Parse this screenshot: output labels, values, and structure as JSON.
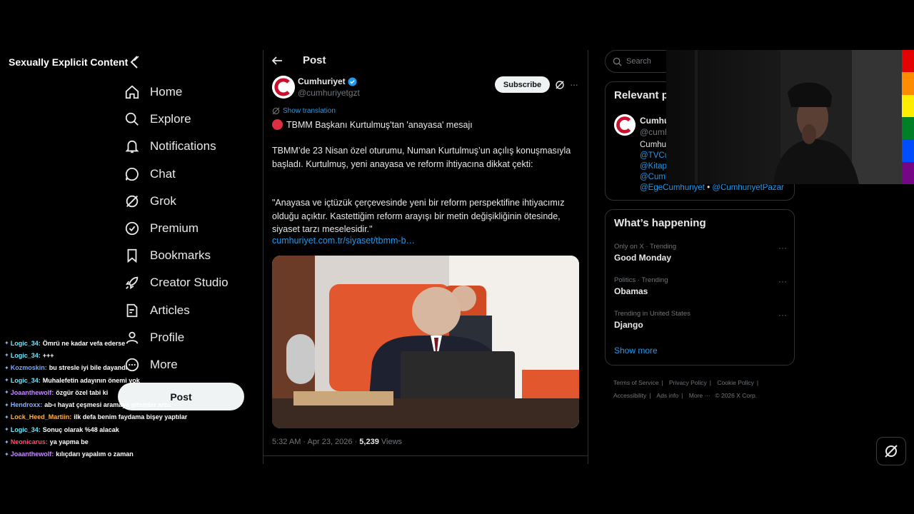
{
  "overlay": {
    "content_warning": "Sexually Explicit Content"
  },
  "nav": {
    "items": [
      {
        "label": "Home",
        "icon": "home-icon"
      },
      {
        "label": "Explore",
        "icon": "search-icon"
      },
      {
        "label": "Notifications",
        "icon": "bell-icon"
      },
      {
        "label": "Chat",
        "icon": "chat-bubble-icon"
      },
      {
        "label": "Grok",
        "icon": "grok-icon"
      },
      {
        "label": "Premium",
        "icon": "premium-badge-icon"
      },
      {
        "label": "Bookmarks",
        "icon": "bookmark-icon"
      },
      {
        "label": "Creator Studio",
        "icon": "rocket-icon"
      },
      {
        "label": "Articles",
        "icon": "article-edit-icon"
      },
      {
        "label": "Profile",
        "icon": "person-icon"
      },
      {
        "label": "More",
        "icon": "more-circle-icon"
      }
    ],
    "post_button": "Post"
  },
  "chat": {
    "messages": [
      {
        "user": "Logic_34:",
        "color": "#6ee7ff",
        "text": "Ömrü ne kadar vefa ederse"
      },
      {
        "user": "Logic_34:",
        "color": "#6ee7ff",
        "text": "+++"
      },
      {
        "user": "Kozmoskin:",
        "color": "#7aa7ff",
        "text": "bu stresle iyi bile dayandı"
      },
      {
        "user": "Logic_34:",
        "color": "#6ee7ff",
        "text": "Muhalefetin adayının önemi yok"
      },
      {
        "user": "Joaanthewolf:",
        "color": "#c98cff",
        "text": "özgür özel tabi ki"
      },
      {
        "user": "Hendroxx:",
        "color": "#8ab4ff",
        "text": "ab-ı hayat çeşmesi aramaya gitsinler artık"
      },
      {
        "user": "Lock_Heed_Martiin:",
        "color": "#ffb347",
        "text": "ilk defa benim faydama bişey yaptılar"
      },
      {
        "user": "Logic_34:",
        "color": "#6ee7ff",
        "text": "Sonuç olarak %48 alacak"
      },
      {
        "user": "Neonicarus:",
        "color": "#ff4d6d",
        "text": "ya yapma be"
      },
      {
        "user": "Joaanthewolf:",
        "color": "#c98cff",
        "text": "kılıçdarı yapalım o zaman"
      }
    ]
  },
  "post": {
    "page_title": "Post",
    "author_name": "Cumhuriyet",
    "author_handle": "@cumhuriyetgzt",
    "subscribe_label": "Subscribe",
    "show_translation": "Show translation",
    "headline": "TBMM Başkanı Kurtulmuş'tan 'anayasa' mesajı",
    "paragraph1": "TBMM’de 23 Nisan özel oturumu, Numan Kurtulmuş’un açılış konuşmasıyla başladı. Kurtulmuş, yeni anayasa ve reform ihtiyacına dikkat çekti:",
    "paragraph2": "\"Anayasa ve içtüzük çerçevesinde yeni bir reform perspektifine ihtiyacımız olduğu açıktır. Kastettiğim reform arayışı bir metin değişikliğinin ötesinde, siyaset tarzı meselesidir.\"",
    "link": "cumhuriyet.com.tr/siyaset/tbmm-b…",
    "timestamp": "5:32 AM · Apr 23, 2026 · ",
    "views_count": "5,239",
    "views_label": " Views"
  },
  "right": {
    "search_placeholder": "Search",
    "relevant_title": "Relevant people",
    "relevant_name": "Cumhuriyet",
    "relevant_handle": "@cumhuriyetgzt",
    "relevant_bio": "Cumhuriyet",
    "mentions": [
      "@TVCumhuriyet",
      "@KitapCumhuriyet",
      "@CumhuriyetBilim"
    ],
    "last_mention_a": "@EgeCumhuriyet",
    "last_sep": " • ",
    "last_mention_b": "@CumhuriyetPazar",
    "happening_title": "What’s happening",
    "trends": [
      {
        "context": "Only on X · Trending",
        "name": "Good Monday"
      },
      {
        "context": "Politics · Trending",
        "name": "Obamas"
      },
      {
        "context": "Trending in United States",
        "name": "Django"
      }
    ],
    "show_more": "Show more",
    "footer": [
      "Terms of Service",
      "Privacy Policy",
      "Cookie Policy",
      "Accessibility",
      "Ads info",
      "More ···",
      "© 2026 X Corp."
    ]
  },
  "colors": {
    "accent": "#1d9bf0",
    "background": "#000000",
    "border": "#2f3336",
    "brand_red": "#c8102e"
  }
}
